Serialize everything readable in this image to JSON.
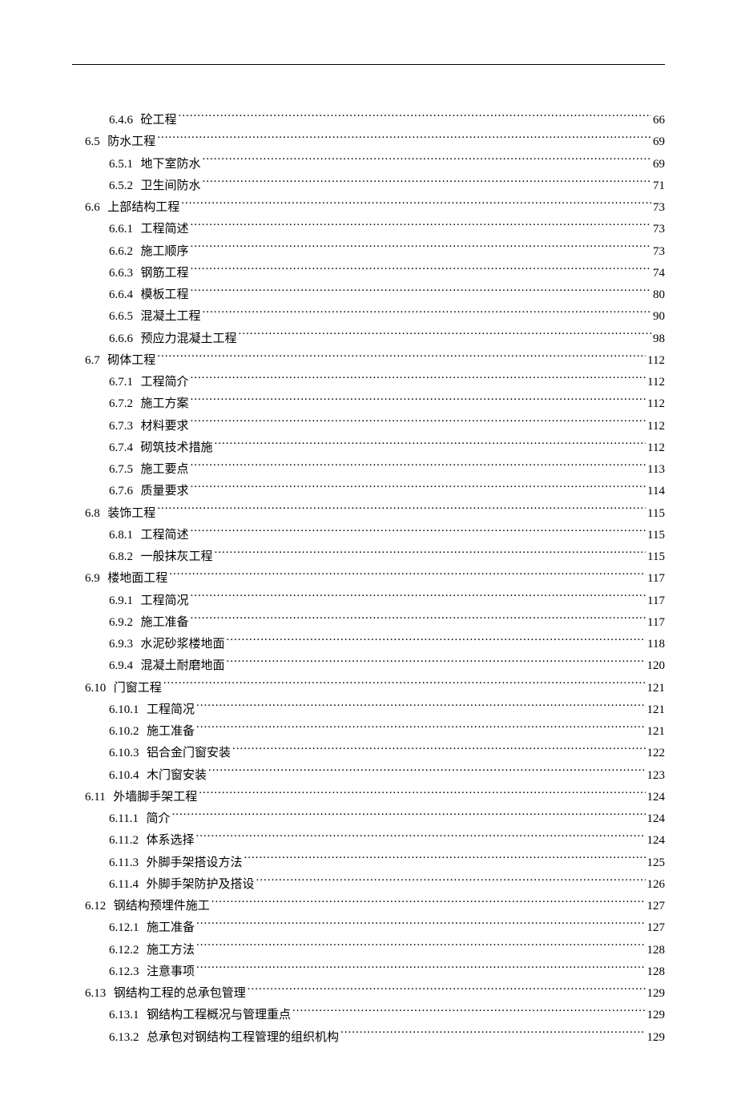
{
  "toc": [
    {
      "lvl": 2,
      "num": "6.4.6",
      "title": "砼工程",
      "page": "66"
    },
    {
      "lvl": 1,
      "num": "6.5",
      "title": "防水工程",
      "page": "69"
    },
    {
      "lvl": 2,
      "num": "6.5.1",
      "title": "地下室防水",
      "page": "69"
    },
    {
      "lvl": 2,
      "num": "6.5.2",
      "title": "卫生间防水",
      "page": "71"
    },
    {
      "lvl": 1,
      "num": "6.6",
      "title": "上部结构工程",
      "page": "73"
    },
    {
      "lvl": 2,
      "num": "6.6.1",
      "title": "工程简述",
      "page": "73"
    },
    {
      "lvl": 2,
      "num": "6.6.2",
      "title": "施工顺序",
      "page": "73"
    },
    {
      "lvl": 2,
      "num": "6.6.3",
      "title": "钢筋工程",
      "page": "74"
    },
    {
      "lvl": 2,
      "num": "6.6.4",
      "title": "模板工程",
      "page": "80"
    },
    {
      "lvl": 2,
      "num": "6.6.5",
      "title": "混凝土工程",
      "page": "90"
    },
    {
      "lvl": 2,
      "num": "6.6.6",
      "title": "预应力混凝土工程",
      "page": "98"
    },
    {
      "lvl": 1,
      "num": "6.7",
      "title": "砌体工程",
      "page": "112"
    },
    {
      "lvl": 2,
      "num": "6.7.1",
      "title": "工程简介",
      "page": "112"
    },
    {
      "lvl": 2,
      "num": "6.7.2",
      "title": "施工方案",
      "page": "112"
    },
    {
      "lvl": 2,
      "num": "6.7.3",
      "title": "材料要求",
      "page": "112"
    },
    {
      "lvl": 2,
      "num": "6.7.4",
      "title": "砌筑技术措施",
      "page": "112"
    },
    {
      "lvl": 2,
      "num": "6.7.5",
      "title": "施工要点",
      "page": "113"
    },
    {
      "lvl": 2,
      "num": "6.7.6",
      "title": "质量要求",
      "page": "114"
    },
    {
      "lvl": 1,
      "num": "6.8",
      "title": "装饰工程",
      "page": "115"
    },
    {
      "lvl": 2,
      "num": "6.8.1",
      "title": "工程简述",
      "page": "115"
    },
    {
      "lvl": 2,
      "num": "6.8.2",
      "title": "一般抹灰工程",
      "page": "115"
    },
    {
      "lvl": 1,
      "num": "6.9",
      "title": "楼地面工程",
      "page": "117"
    },
    {
      "lvl": 2,
      "num": "6.9.1",
      "title": "工程简况",
      "page": "117"
    },
    {
      "lvl": 2,
      "num": "6.9.2",
      "title": "施工准备",
      "page": "117"
    },
    {
      "lvl": 2,
      "num": "6.9.3",
      "title": "水泥砂浆楼地面",
      "page": "118"
    },
    {
      "lvl": 2,
      "num": "6.9.4",
      "title": "混凝土耐磨地面",
      "page": "120"
    },
    {
      "lvl": 1,
      "num": "6.10",
      "title": "门窗工程",
      "page": "121"
    },
    {
      "lvl": 2,
      "num": "6.10.1",
      "title": "工程简况",
      "page": "121"
    },
    {
      "lvl": 2,
      "num": "6.10.2",
      "title": "施工准备",
      "page": "121"
    },
    {
      "lvl": 2,
      "num": "6.10.3",
      "title": "铝合金门窗安装",
      "page": "122"
    },
    {
      "lvl": 2,
      "num": "6.10.4",
      "title": "木门窗安装",
      "page": "123"
    },
    {
      "lvl": 1,
      "num": "6.11",
      "title": "外墙脚手架工程",
      "page": "124"
    },
    {
      "lvl": 2,
      "num": "6.11.1",
      "title": "简介",
      "page": "124"
    },
    {
      "lvl": 2,
      "num": "6.11.2",
      "title": "体系选择",
      "page": "124"
    },
    {
      "lvl": 2,
      "num": "6.11.3",
      "title": "外脚手架搭设方法",
      "page": "125"
    },
    {
      "lvl": 2,
      "num": "6.11.4",
      "title": "外脚手架防护及搭设",
      "page": "126"
    },
    {
      "lvl": 1,
      "num": "6.12",
      "title": "钢结构预埋件施工",
      "page": "127"
    },
    {
      "lvl": 2,
      "num": "6.12.1",
      "title": "施工准备",
      "page": "127"
    },
    {
      "lvl": 2,
      "num": "6.12.2",
      "title": "施工方法",
      "page": "128"
    },
    {
      "lvl": 2,
      "num": "6.12.3",
      "title": "注意事项",
      "page": "128"
    },
    {
      "lvl": 1,
      "num": "6.13",
      "title": "钢结构工程的总承包管理",
      "page": "129"
    },
    {
      "lvl": 2,
      "num": "6.13.1",
      "title": "钢结构工程概况与管理重点",
      "page": "129"
    },
    {
      "lvl": 2,
      "num": "6.13.2",
      "title": "总承包对钢结构工程管理的组织机构",
      "page": "129"
    }
  ]
}
